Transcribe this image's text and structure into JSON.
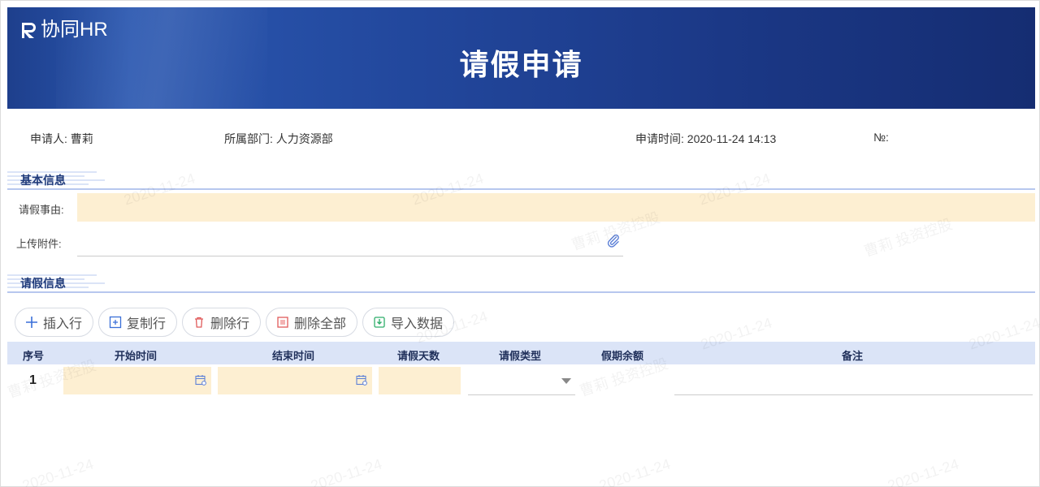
{
  "app": {
    "logo_text": "协同HR",
    "page_title": "请假申请"
  },
  "meta": {
    "applicant_label": "申请人:",
    "applicant_value": "曹莉",
    "department_label": "所属部门:",
    "department_value": "人力资源部",
    "time_label": "申请时间:",
    "time_value": "2020-11-24 14:13",
    "number_label": "№:"
  },
  "sections": {
    "basic": "基本信息",
    "leave": "请假信息"
  },
  "fields": {
    "reason_label": "请假事由:",
    "attachment_label": "上传附件:"
  },
  "toolbar": {
    "insert_row": "插入行",
    "copy_row": "复制行",
    "delete_row": "删除行",
    "delete_all": "删除全部",
    "import_data": "导入数据"
  },
  "table": {
    "headers": [
      "序号",
      "开始时间",
      "结束时间",
      "请假天数",
      "请假类型",
      "假期余额",
      "备注"
    ],
    "rows": [
      {
        "index": "1"
      }
    ]
  },
  "watermark": {
    "name_text": "曹莉 投资控股",
    "date_text": "2020-11-24"
  },
  "colors": {
    "banner": "#1e3f8c",
    "required_field": "#fdefd2",
    "table_header": "#dbe4f7",
    "section_title": "#1f3a7a"
  }
}
